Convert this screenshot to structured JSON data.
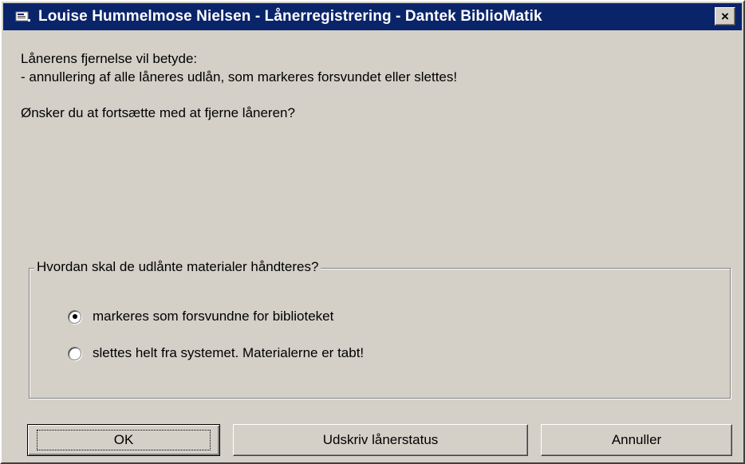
{
  "window": {
    "title": "Louise Hummelmose Nielsen - Lånerregistrering - Dantek BiblioMatik",
    "close_glyph": "×"
  },
  "message": {
    "line1": "Lånerens fjernelse vil betyde:",
    "line2": "- annullering af alle låneres udlån, som markeres forsvundet eller slettes!",
    "question": "Ønsker du at fortsætte med at fjerne låneren?"
  },
  "group": {
    "legend": "Hvordan skal de udlånte materialer håndteres?",
    "options": [
      {
        "label": "markeres som forsvundne for biblioteket",
        "selected": true
      },
      {
        "label": "slettes helt fra systemet. Materialerne er tabt!",
        "selected": false
      }
    ]
  },
  "buttons": {
    "ok": "OK",
    "print": "Udskriv lånerstatus",
    "cancel": "Annuller"
  },
  "colors": {
    "titlebar": "#0a246a",
    "dialog_face": "#d4d0c8"
  },
  "icons": {
    "app": "app-window-icon",
    "close": "close-icon"
  }
}
